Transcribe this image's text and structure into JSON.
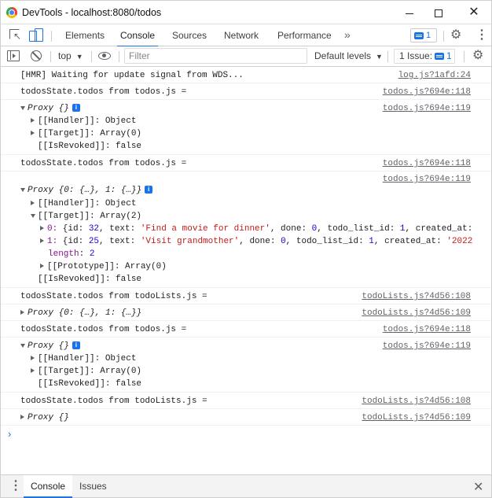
{
  "window": {
    "title": "DevTools - localhost:8080/todos",
    "minimize_glyph": "",
    "close_glyph": "✕"
  },
  "tabs": [
    {
      "label": "Elements"
    },
    {
      "label": "Console"
    },
    {
      "label": "Sources"
    },
    {
      "label": "Network"
    },
    {
      "label": "Performance"
    }
  ],
  "tabbar": {
    "more_glyph": "»",
    "messages_count": "1",
    "settings_glyph": "⚙",
    "kebab_glyph": "⋮"
  },
  "toolbar": {
    "context": "top",
    "filter_placeholder": "Filter",
    "levels": "Default levels",
    "issues_label": "1 Issue:",
    "issues_count": "1",
    "caret": "▼",
    "settings_glyph": "⚙"
  },
  "console": {
    "rows": [
      {
        "text": "[HMR] Waiting for update signal from WDS...",
        "source": "log.js?1afd:24"
      },
      {
        "text": "todosState.todos from todos.js =",
        "source": "todos.js?694e:118"
      },
      {
        "proxy": "Proxy {}",
        "source": "todos.js?694e:119",
        "children": [
          "[[Handler]]: Object",
          "[[Target]]: Array(0)",
          "[[IsRevoked]]: false"
        ]
      },
      {
        "text": "todosState.todos from todos.js =",
        "source": "todos.js?694e:118"
      },
      {
        "source": "todos.js?694e:119"
      },
      {
        "proxy": "Proxy {0: {…}, 1: {…}}",
        "children": [
          "[[Handler]]: Object",
          "[[Target]]: Array(2)"
        ],
        "items": [
          {
            "idx": "0:",
            "open": " {id: ",
            "id": "32",
            "t1": ", text: ",
            "text": "'Find a movie for dinner'",
            "t2": ", done: ",
            "done": "0",
            "t3": ", todo_list_id: ",
            "list": "1",
            "t4": ", created_at:"
          },
          {
            "idx": "1:",
            "open": " {id: ",
            "id": "25",
            "t1": ", text: ",
            "text": "'Visit grandmother'",
            "t2": ", done: ",
            "done": "0",
            "t3": ", todo_list_id: ",
            "list": "1",
            "t4": ", created_at: ",
            "tail": "'2022"
          }
        ],
        "length_key": "length",
        "length_val": "2",
        "prototype": "[[Prototype]]: Array(0)",
        "revoked": "[[IsRevoked]]: false"
      },
      {
        "text": "todosState.todos from todoLists.js =",
        "source": "todoLists.js?4d56:108"
      },
      {
        "proxy": "Proxy {0: {…}, 1: {…}}",
        "source": "todoLists.js?4d56:109"
      },
      {
        "text": "todosState.todos from todos.js =",
        "source": "todos.js?694e:118"
      },
      {
        "proxy": "Proxy {}",
        "source": "todos.js?694e:119",
        "children": [
          "[[Handler]]: Object",
          "[[Target]]: Array(0)",
          "[[IsRevoked]]: false"
        ]
      },
      {
        "text": "todosState.todos from todoLists.js =",
        "source": "todoLists.js?4d56:108"
      },
      {
        "proxy": "Proxy {}",
        "source": "todoLists.js?4d56:109"
      }
    ],
    "prompt_glyph": "›"
  },
  "drawer": {
    "tabs": [
      {
        "label": "Console"
      },
      {
        "label": "Issues"
      }
    ],
    "kebab_glyph": "⋮",
    "close_glyph": "✕"
  }
}
